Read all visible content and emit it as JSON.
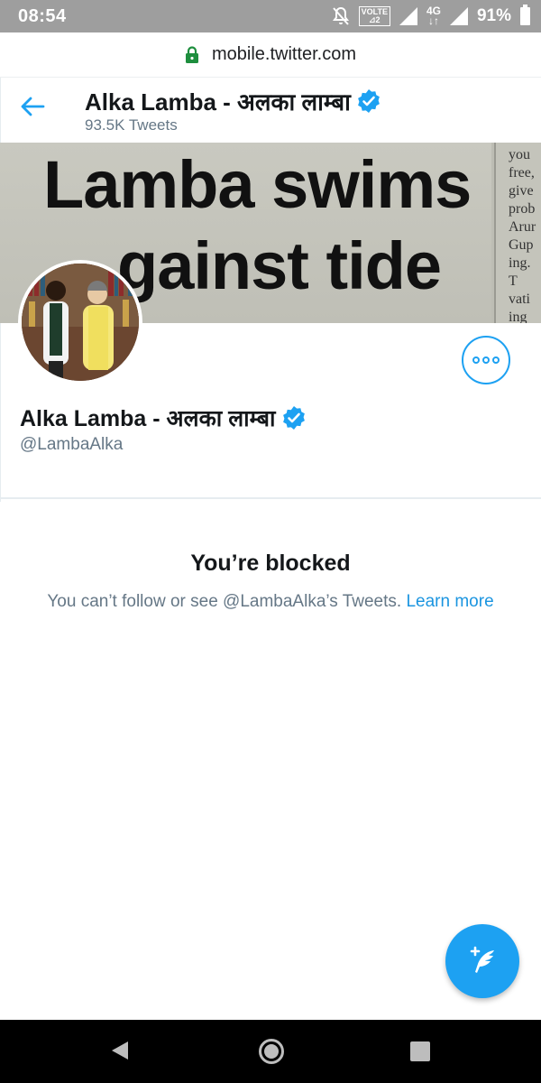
{
  "status_bar": {
    "time": "08:54",
    "volte_label": "VOLTE",
    "network_label": "4G",
    "battery": "91%"
  },
  "url_bar": {
    "url": "mobile.twitter.com"
  },
  "header": {
    "name": "Alka Lamba - अलका लाम्बा",
    "tweet_count": "93.5K Tweets"
  },
  "banner": {
    "headline_line1": "Lamba swims",
    "headline_line2": "gainst tide",
    "side_column": [
      "you",
      "free,",
      "give",
      "prob",
      "Arur",
      "Gup",
      "ing.",
      "T",
      "vati",
      "ing"
    ]
  },
  "profile": {
    "name": "Alka Lamba - अलका लाम्बा",
    "handle": "@LambaAlka"
  },
  "blocked": {
    "title": "You’re blocked",
    "message": "You can’t follow or see @LambaAlka’s Tweets.",
    "link": "Learn more"
  },
  "colors": {
    "accent": "#1da1f2",
    "status_bar": "#9e9e9e",
    "secondary_text": "#657786",
    "lock_green": "#1e8e3e"
  }
}
